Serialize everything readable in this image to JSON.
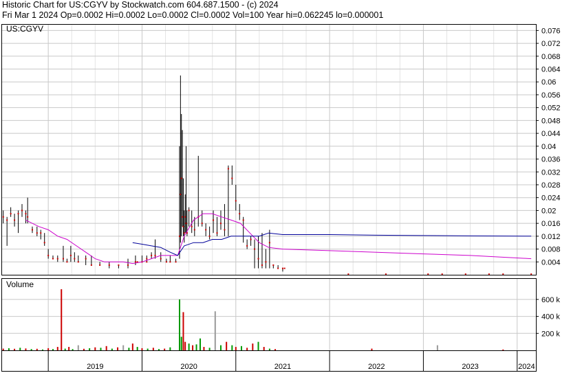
{
  "header": {
    "title": "Historic Chart for US:CGYV by Stockwatch.com 604.687.1500 - (c) 2024",
    "quote": "Fri Mar  1 2024   Op=0.0002   Hi=0.0002   Lo=0.0002   Cl=0.0002   Vol=100   Year hi=0.062245   lo=0.000001"
  },
  "symbol_label": "US:CGYV",
  "volume_label": "Volume",
  "colors": {
    "price_bar": "#000000",
    "close_dot": "#cc0000",
    "ma_short": "#cc00cc",
    "ma_long": "#000099",
    "vol_up": "#009900",
    "vol_down": "#cc0000",
    "vol_flat": "#999999",
    "grid": "#c8c8c8",
    "frame": "#000000"
  },
  "chart_data": [
    {
      "type": "line",
      "title": "US:CGYV",
      "ylim": [
        0,
        0.078
      ],
      "yticks": [
        "0.004",
        "0.008",
        "0.012",
        "0.016",
        "0.02",
        "0.024",
        "0.028",
        "0.032",
        "0.036",
        "0.04",
        "0.044",
        "0.048",
        "0.052",
        "0.056",
        "0.06",
        "0.064",
        "0.068",
        "0.072",
        "0.076"
      ],
      "x_labels": [
        "2019",
        "2020",
        "2021",
        "2022",
        "2023",
        "2024"
      ],
      "x_label_positions_year": [
        2019.0,
        2020.0,
        2021.0,
        2022.0,
        2023.0,
        2024.0
      ],
      "x_start": 2018.5,
      "x_end": 2024.2,
      "price_bars": [
        [
          2018.52,
          0.018,
          0.02,
          0.016
        ],
        [
          2018.56,
          0.017,
          0.018,
          0.009
        ],
        [
          2018.6,
          0.019,
          0.021,
          0.018
        ],
        [
          2018.64,
          0.017,
          0.019,
          0.015
        ],
        [
          2018.68,
          0.019,
          0.02,
          0.013
        ],
        [
          2018.72,
          0.02,
          0.022,
          0.018
        ],
        [
          2018.76,
          0.019,
          0.02,
          0.016
        ],
        [
          2018.78,
          0.018,
          0.024,
          0.016
        ],
        [
          2018.83,
          0.014,
          0.015,
          0.013
        ],
        [
          2018.88,
          0.013,
          0.015,
          0.012
        ],
        [
          2018.92,
          0.013,
          0.014,
          0.011
        ],
        [
          2018.96,
          0.01,
          0.013,
          0.009
        ],
        [
          2019.0,
          0.006,
          0.008,
          0.005
        ],
        [
          2019.05,
          0.005,
          0.006,
          0.005
        ],
        [
          2019.1,
          0.005,
          0.006,
          0.004
        ],
        [
          2019.16,
          0.005,
          0.009,
          0.004
        ],
        [
          2019.2,
          0.004,
          0.005,
          0.004
        ],
        [
          2019.24,
          0.006,
          0.009,
          0.004
        ],
        [
          2019.28,
          0.005,
          0.007,
          0.004
        ],
        [
          2019.32,
          0.004,
          0.006,
          0.004
        ],
        [
          2019.4,
          0.005,
          0.006,
          0.003
        ],
        [
          2019.46,
          0.003,
          0.006,
          0.003
        ],
        [
          2019.55,
          0.003,
          0.004,
          0.003
        ],
        [
          2019.65,
          0.003,
          0.004,
          0.002
        ],
        [
          2019.75,
          0.003,
          0.003,
          0.002
        ],
        [
          2019.85,
          0.003,
          0.005,
          0.002
        ],
        [
          2019.93,
          0.004,
          0.006,
          0.003
        ],
        [
          2020.0,
          0.004,
          0.006,
          0.004
        ],
        [
          2020.05,
          0.005,
          0.006,
          0.004
        ],
        [
          2020.1,
          0.006,
          0.007,
          0.005
        ],
        [
          2020.14,
          0.006,
          0.011,
          0.005
        ],
        [
          2020.2,
          0.005,
          0.007,
          0.004
        ],
        [
          2020.26,
          0.004,
          0.005,
          0.004
        ],
        [
          2020.3,
          0.004,
          0.006,
          0.004
        ],
        [
          2020.36,
          0.004,
          0.005,
          0.004
        ],
        [
          2020.4,
          0.012,
          0.04,
          0.005
        ],
        [
          2020.41,
          0.025,
          0.062,
          0.01
        ],
        [
          2020.42,
          0.03,
          0.05,
          0.012
        ],
        [
          2020.43,
          0.018,
          0.045,
          0.015
        ],
        [
          2020.44,
          0.015,
          0.03,
          0.012
        ],
        [
          2020.45,
          0.013,
          0.02,
          0.01
        ],
        [
          2020.46,
          0.018,
          0.025,
          0.013
        ],
        [
          2020.47,
          0.016,
          0.04,
          0.013
        ],
        [
          2020.48,
          0.013,
          0.02,
          0.012
        ],
        [
          2020.5,
          0.02,
          0.021,
          0.015
        ],
        [
          2020.53,
          0.015,
          0.02,
          0.013
        ],
        [
          2020.56,
          0.014,
          0.018,
          0.012
        ],
        [
          2020.6,
          0.018,
          0.037,
          0.015
        ],
        [
          2020.64,
          0.016,
          0.02,
          0.015
        ],
        [
          2020.68,
          0.014,
          0.016,
          0.012
        ],
        [
          2020.72,
          0.012,
          0.015,
          0.011
        ],
        [
          2020.76,
          0.017,
          0.02,
          0.013
        ],
        [
          2020.8,
          0.013,
          0.018,
          0.012
        ],
        [
          2020.84,
          0.016,
          0.02,
          0.014
        ],
        [
          2020.88,
          0.014,
          0.022,
          0.012
        ],
        [
          2020.92,
          0.033,
          0.034,
          0.012
        ],
        [
          2020.96,
          0.03,
          0.034,
          0.028
        ],
        [
          2021.0,
          0.023,
          0.028,
          0.02
        ],
        [
          2021.04,
          0.019,
          0.022,
          0.017
        ],
        [
          2021.08,
          0.017,
          0.018,
          0.01
        ],
        [
          2021.12,
          0.009,
          0.011,
          0.008
        ],
        [
          2021.16,
          0.011,
          0.012,
          0.009
        ],
        [
          2021.2,
          0.008,
          0.011,
          0.002
        ],
        [
          2021.24,
          0.005,
          0.012,
          0.002
        ],
        [
          2021.28,
          0.003,
          0.013,
          0.002
        ],
        [
          2021.32,
          0.004,
          0.008,
          0.002
        ],
        [
          2021.36,
          0.01,
          0.014,
          0.002
        ],
        [
          2021.4,
          0.003,
          0.003,
          0.002
        ],
        [
          2021.45,
          0.002,
          0.003,
          0.002
        ],
        [
          2021.5,
          0.002,
          0.002,
          0.001
        ]
      ],
      "series": [
        {
          "kind": "ma_short",
          "x": [
            2018.76,
            2018.9,
            2019.0,
            2019.1,
            2019.2,
            2019.3,
            2019.4,
            2019.5,
            2019.6,
            2019.7,
            2019.8,
            2019.9,
            2020.0,
            2020.1,
            2020.2,
            2020.3,
            2020.38,
            2020.45,
            2020.55,
            2020.65,
            2020.75,
            2020.85,
            2020.95,
            2021.05,
            2021.15,
            2021.25,
            2021.35,
            2021.5,
            2022.0,
            2022.5,
            2023.0,
            2023.5,
            2024.15
          ],
          "values": [
            0.017,
            0.015,
            0.014,
            0.012,
            0.011,
            0.009,
            0.007,
            0.005,
            0.004,
            0.004,
            0.004,
            0.0035,
            0.004,
            0.005,
            0.006,
            0.006,
            0.006,
            0.012,
            0.017,
            0.019,
            0.019,
            0.018,
            0.017,
            0.016,
            0.013,
            0.01,
            0.0085,
            0.008,
            0.0075,
            0.007,
            0.0065,
            0.006,
            0.005
          ]
        },
        {
          "kind": "ma_long",
          "x": [
            2019.9,
            2020.0,
            2020.1,
            2020.2,
            2020.3,
            2020.38,
            2020.45,
            2020.55,
            2020.65,
            2020.75,
            2020.85,
            2020.95,
            2021.05,
            2021.15,
            2021.25,
            2021.35,
            2021.5,
            2022.0,
            2022.5,
            2023.0,
            2023.5,
            2024.15
          ],
          "values": [
            0.01,
            0.0095,
            0.009,
            0.0085,
            0.007,
            0.006,
            0.009,
            0.01,
            0.01,
            0.011,
            0.011,
            0.012,
            0.012,
            0.012,
            0.012,
            0.013,
            0.0125,
            0.0125,
            0.0123,
            0.0122,
            0.0121,
            0.012
          ]
        }
      ],
      "close_dots": [
        [
          2019.95,
          0.004
        ],
        [
          2020.0,
          0.004
        ],
        [
          2020.05,
          0.004
        ],
        [
          2021.52,
          0.002
        ],
        [
          2022.2,
          0.0002
        ],
        [
          2022.6,
          0.0002
        ],
        [
          2023.05,
          0.0002
        ],
        [
          2023.2,
          0.0002
        ],
        [
          2023.45,
          0.0002
        ],
        [
          2023.7,
          0.0002
        ],
        [
          2023.85,
          0.0002
        ],
        [
          2024.15,
          0.0002
        ]
      ]
    },
    {
      "type": "bar",
      "title": "Volume",
      "ylim": [
        0,
        850
      ],
      "yticks": [
        "200 k",
        "400 k",
        "600 k"
      ],
      "ytick_values": [
        200,
        400,
        600
      ],
      "bars": [
        [
          2018.52,
          20,
          "down"
        ],
        [
          2018.58,
          25,
          "up"
        ],
        [
          2018.64,
          18,
          "down"
        ],
        [
          2018.7,
          30,
          "up"
        ],
        [
          2018.76,
          22,
          "down"
        ],
        [
          2018.82,
          15,
          "up"
        ],
        [
          2018.88,
          18,
          "down"
        ],
        [
          2018.94,
          10,
          "up"
        ],
        [
          2019.0,
          25,
          "down"
        ],
        [
          2019.05,
          15,
          "up"
        ],
        [
          2019.1,
          40,
          "down"
        ],
        [
          2019.14,
          720,
          "down"
        ],
        [
          2019.18,
          20,
          "up"
        ],
        [
          2019.22,
          40,
          "down"
        ],
        [
          2019.26,
          15,
          "up"
        ],
        [
          2019.32,
          60,
          "flat"
        ],
        [
          2019.38,
          18,
          "down"
        ],
        [
          2019.44,
          25,
          "up"
        ],
        [
          2019.5,
          35,
          "down"
        ],
        [
          2019.56,
          30,
          "up"
        ],
        [
          2019.62,
          50,
          "down"
        ],
        [
          2019.68,
          20,
          "up"
        ],
        [
          2019.74,
          35,
          "down"
        ],
        [
          2019.8,
          60,
          "flat"
        ],
        [
          2019.86,
          30,
          "up"
        ],
        [
          2019.9,
          80,
          "down"
        ],
        [
          2019.95,
          40,
          "up"
        ],
        [
          2020.0,
          25,
          "down"
        ],
        [
          2020.06,
          20,
          "up"
        ],
        [
          2020.12,
          30,
          "down"
        ],
        [
          2020.18,
          15,
          "up"
        ],
        [
          2020.24,
          20,
          "down"
        ],
        [
          2020.3,
          35,
          "up"
        ],
        [
          2020.4,
          600,
          "up"
        ],
        [
          2020.42,
          160,
          "up"
        ],
        [
          2020.44,
          450,
          "down"
        ],
        [
          2020.46,
          100,
          "down"
        ],
        [
          2020.5,
          80,
          "up"
        ],
        [
          2020.54,
          60,
          "down"
        ],
        [
          2020.58,
          70,
          "up"
        ],
        [
          2020.62,
          140,
          "up"
        ],
        [
          2020.66,
          40,
          "down"
        ],
        [
          2020.72,
          30,
          "up"
        ],
        [
          2020.78,
          460,
          "flat"
        ],
        [
          2020.84,
          60,
          "up"
        ],
        [
          2020.9,
          100,
          "down"
        ],
        [
          2020.96,
          60,
          "up"
        ],
        [
          2021.0,
          40,
          "down"
        ],
        [
          2021.06,
          50,
          "up"
        ],
        [
          2021.12,
          30,
          "down"
        ],
        [
          2021.18,
          80,
          "down"
        ],
        [
          2021.24,
          100,
          "up"
        ],
        [
          2021.3,
          40,
          "down"
        ],
        [
          2021.36,
          20,
          "up"
        ],
        [
          2021.42,
          15,
          "down"
        ],
        [
          2022.45,
          20,
          "down"
        ],
        [
          2023.15,
          60,
          "flat"
        ],
        [
          2023.85,
          10,
          "down"
        ]
      ]
    }
  ]
}
